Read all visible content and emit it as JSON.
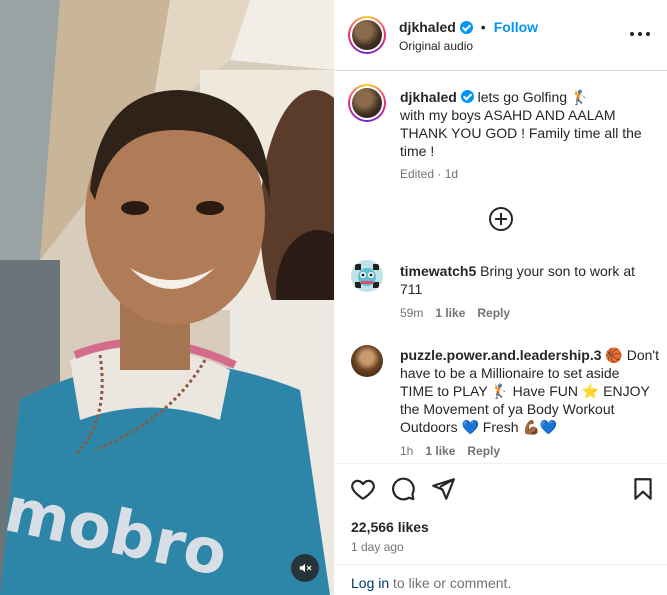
{
  "post": {
    "username": "djkhaled",
    "follow_label": "Follow",
    "audio": "Original audio",
    "separator": "•"
  },
  "caption": {
    "username": "djkhaled",
    "line1": "lets go Golfing 🏌",
    "line2": "with my boys ASAHD AND AALAM",
    "line3": "THANK YOU GOD ! Family time all the",
    "line4": "time !",
    "meta": "Edited · 1d"
  },
  "comments": [
    {
      "username": "timewatch5",
      "text_part1": "Bring your son to work at",
      "text_part2": "711",
      "time": "59m",
      "likes": "1 like",
      "reply": "Reply"
    },
    {
      "username": "puzzle.power.and.leadership.3",
      "text_l1": "🏀 Don't",
      "text_l2": "have to be a Millionaire to set aside",
      "text_l3": "TIME to PLAY 🏌 Have FUN ⭐ ENJOY",
      "text_l4": "the Movement of ya Body Workout",
      "text_l5": "Outdoors 💙 Fresh 💪🏾💙",
      "time": "1h",
      "likes": "1 like",
      "reply": "Reply"
    }
  ],
  "stats": {
    "likes": "22,566 likes",
    "ago": "1 day ago"
  },
  "footer": {
    "login": "Log in",
    "rest": " to like or comment."
  },
  "icons": {
    "more": "more-options-icon",
    "add": "add-circle-icon",
    "like": "heart-icon",
    "comment": "comment-icon",
    "share": "share-icon",
    "save": "bookmark-icon",
    "mute": "speaker-muted-icon"
  },
  "colors": {
    "accent": "#0095f6",
    "link": "#00376b",
    "muted": "#737373"
  }
}
